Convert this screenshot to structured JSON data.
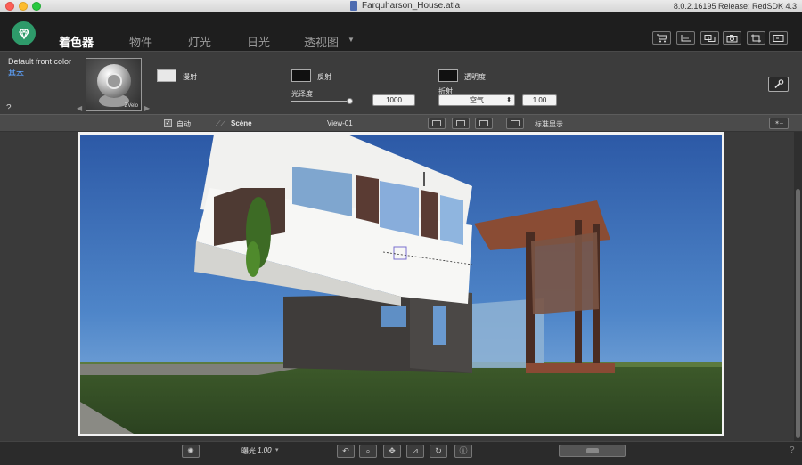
{
  "window": {
    "title": "Farquharson_House.atla",
    "version": "8.0.2.16195 Release; RedSDK 4.3"
  },
  "tabs": [
    {
      "label": "着色器",
      "active": true
    },
    {
      "label": "物件",
      "active": false
    },
    {
      "label": "灯光",
      "active": false
    },
    {
      "label": "日光",
      "active": false
    },
    {
      "label": "透视图",
      "active": false
    }
  ],
  "toolbar_icons": [
    "cart-icon",
    "dimension-icon",
    "views-icon",
    "camera-icon",
    "crop-icon",
    "export-icon"
  ],
  "material": {
    "name": "Default front color",
    "category": "基本",
    "thumb_tag": "ZVelo",
    "help": "?",
    "diffuse_label": "漫射",
    "reflect_label": "反射",
    "gloss_label": "光泽度",
    "gloss_value": "1000",
    "transparency_label": "透明度",
    "refraction_label": "折射",
    "refraction_medium": "空气",
    "refraction_value": "1.00"
  },
  "viewbar": {
    "auto_label": "自动",
    "scene_label": "Scène",
    "view_name": "View-01",
    "display_mode": "标准显示"
  },
  "bottom": {
    "exposure_label": "曝光",
    "exposure_value": "1.00",
    "help": "?"
  },
  "colors": {
    "accent": "#2e9a6a",
    "link": "#5ea4ff"
  }
}
